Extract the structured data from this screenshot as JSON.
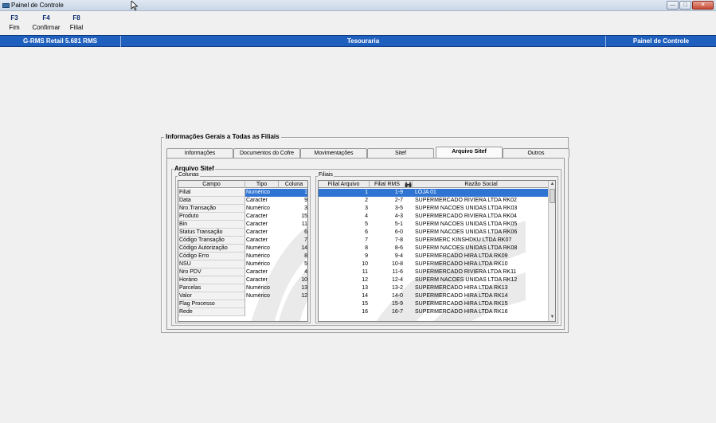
{
  "window": {
    "title": "Painel de Controle"
  },
  "fkeys": [
    {
      "key": "F3",
      "label": "Fim"
    },
    {
      "key": "F4",
      "label": "Confirmar"
    },
    {
      "key": "F8",
      "label": "Filial"
    }
  ],
  "header": {
    "left": "G-RMS Retail 5.681 RMS",
    "center": "Tesouraria",
    "right": "Painel de Controle"
  },
  "frame": {
    "title": "Informações Gerais a Todas as Filiais"
  },
  "tabs": [
    "Informações",
    "Documentos do Cofre",
    "Movimentações",
    "Sitef",
    "Arquivo  Sitef",
    "Outros"
  ],
  "active_tab": 4,
  "section": {
    "title": "Arquivo Sitef"
  },
  "colunas": {
    "label": "Colunas",
    "headers": [
      "Campo",
      "Tipo",
      "Coluna"
    ],
    "rows": [
      [
        "Filial",
        "Numérico",
        "1"
      ],
      [
        "Data",
        "Caracter",
        "9"
      ],
      [
        "Nro.Transação",
        "Numérico",
        "3"
      ],
      [
        "Produto",
        "Caracter",
        "15"
      ],
      [
        "Bin",
        "Caracter",
        "11"
      ],
      [
        "Status Transação",
        "Caracter",
        "6"
      ],
      [
        "Código Transação",
        "Caracter",
        "7"
      ],
      [
        "Código Autorização",
        "Numérico",
        "14"
      ],
      [
        "Código Erro",
        "Numérico",
        "8"
      ],
      [
        "NSU",
        "Numérico",
        "5"
      ],
      [
        "Nro PDV",
        "Caracter",
        "4"
      ],
      [
        "Horário",
        "Caracter",
        "10"
      ],
      [
        "Parcelas",
        "Numérico",
        "13"
      ],
      [
        "Valor",
        "Numérico",
        "12"
      ],
      [
        "Flag Processo",
        "",
        ""
      ],
      [
        "Rede",
        "",
        ""
      ]
    ]
  },
  "filiais": {
    "label": "Filiais",
    "headers": [
      "Filial Arquivo",
      "Filial RMS",
      "",
      "Razão Social"
    ],
    "header_icon": "binoculars-icon",
    "rows": [
      [
        "1",
        "1-9",
        "LOJA 01"
      ],
      [
        "2",
        "2-7",
        "SUPERMERCADO RIVIERA LTDA RK02"
      ],
      [
        "3",
        "3-5",
        "SUPERM NACOES UNIDAS LTDA RK03"
      ],
      [
        "4",
        "4-3",
        "SUPERMERCADO RIVIERA LTDA RK04"
      ],
      [
        "5",
        "5-1",
        "SUPERM NACOES UNIDAS LTDA RK05"
      ],
      [
        "6",
        "6-0",
        "SUPERM NACOES UNIDAS LTDA RK06"
      ],
      [
        "7",
        "7-8",
        "SUPERMERC KINSHDKU LTDA RK07"
      ],
      [
        "8",
        "8-6",
        "SUPERM NACOES UNIDAS LTDA RK08"
      ],
      [
        "9",
        "9-4",
        "SUPERMERCADO HIRA LTDA RK09"
      ],
      [
        "10",
        "10-8",
        "SUPERMERCADO HIRA LTDA RK10"
      ],
      [
        "11",
        "11-6",
        "SUPERMERCADO RIVIERA LTDA RK11"
      ],
      [
        "12",
        "12-4",
        "SUPERM NACOES UNIDAS LTDA RK12"
      ],
      [
        "13",
        "13-2",
        "SUPERMERCADO HIRA LTDA RK13"
      ],
      [
        "14",
        "14-0",
        "SUPERMERCADO HIRA LTDA RK14"
      ],
      [
        "15",
        "15-9",
        "SUPERMERCADO HIRA LTDA RK15"
      ],
      [
        "16",
        "16-7",
        "SUPERMERCADO HIRA LTDA RK16"
      ]
    ]
  },
  "colors": {
    "header_bar": "#1f5fbd",
    "selection": "#2f74d3",
    "fkey": "#0a2a6e"
  }
}
